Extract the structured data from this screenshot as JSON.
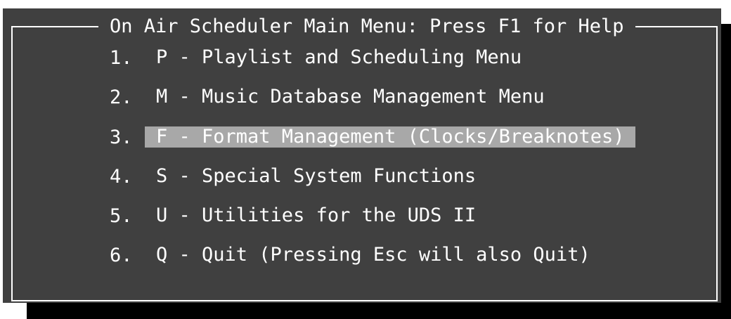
{
  "window": {
    "title": "On Air Scheduler Main Menu: Press F1 for Help"
  },
  "menu": {
    "items": [
      {
        "number": "1.",
        "label": "P - Playlist and Scheduling Menu",
        "selected": false
      },
      {
        "number": "2.",
        "label": "M - Music Database Management Menu",
        "selected": false
      },
      {
        "number": "3.",
        "label": "F - Format Management (Clocks/Breaknotes)",
        "selected": true
      },
      {
        "number": "4.",
        "label": "S - Special System Functions",
        "selected": false
      },
      {
        "number": "5.",
        "label": "U - Utilities for the UDS II",
        "selected": false
      },
      {
        "number": "6.",
        "label": "Q - Quit (Pressing Esc will also Quit)",
        "selected": false
      }
    ]
  },
  "colors": {
    "panel_background": "#404040",
    "shadow": "#000000",
    "text": "#ffffff",
    "highlight": "#a8a8a8"
  }
}
